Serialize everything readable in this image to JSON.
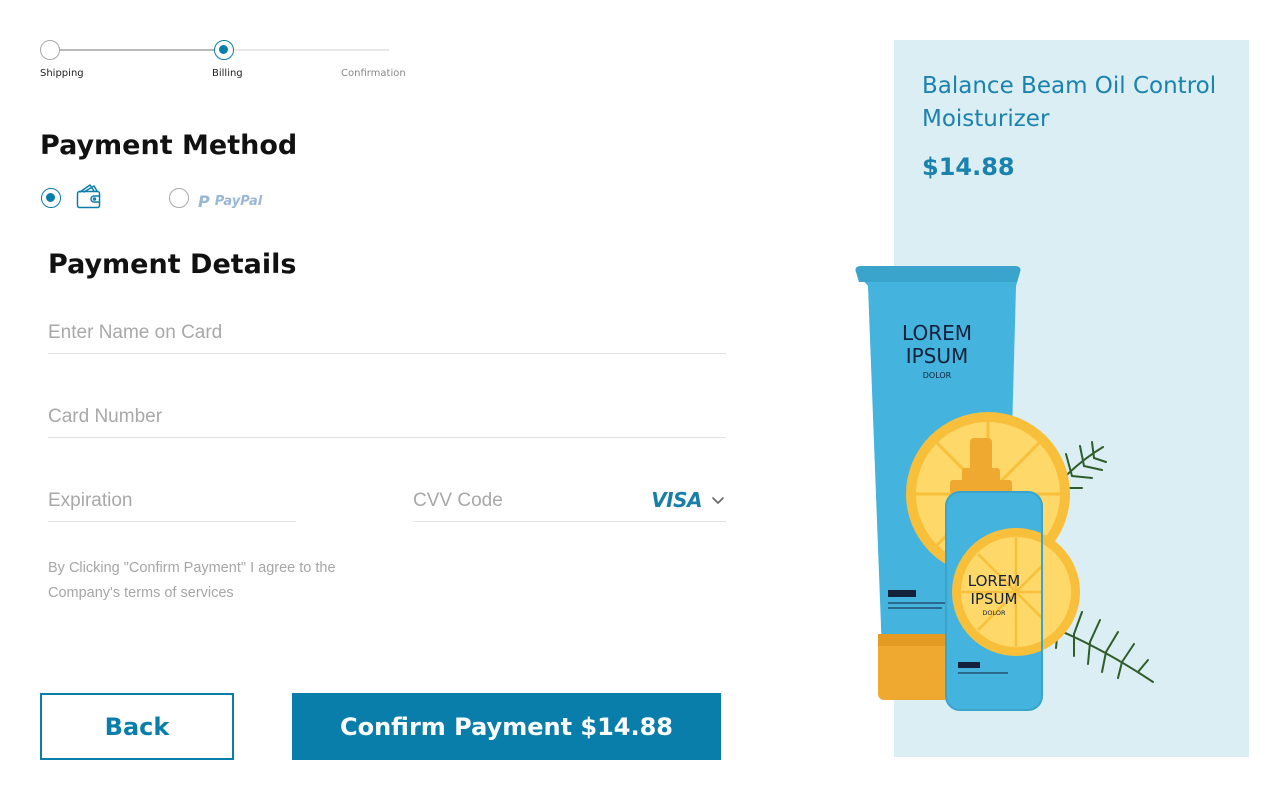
{
  "stepper": {
    "steps": [
      {
        "label": "Shipping",
        "state": "completed"
      },
      {
        "label": "Billing",
        "state": "active"
      },
      {
        "label": "Confirmation",
        "state": "pending"
      }
    ]
  },
  "payment_method": {
    "title": "Payment Method",
    "options": [
      {
        "icon": "wallet-icon",
        "selected": true
      },
      {
        "label": "PayPal",
        "selected": false
      }
    ]
  },
  "payment_details": {
    "title": "Payment Details",
    "name_placeholder": "Enter Name on Card",
    "card_placeholder": "Card Number",
    "expiration_placeholder": "Expiration",
    "cvv_placeholder": "CVV Code",
    "card_brand": "VISA"
  },
  "terms_text": "By Clicking \"Confirm Payment\" I agree to the Company's terms of services",
  "buttons": {
    "back_label": "Back",
    "confirm_label": "Confirm Payment $14.88"
  },
  "product": {
    "name": "Balance Beam Oil Control Moisturizer",
    "price": "$14.88",
    "tube_text": [
      "LOREM",
      "IPSUM",
      "DOLOR"
    ],
    "bottle_text": [
      "LOREM",
      "IPSUM",
      "DOLOR"
    ]
  },
  "colors": {
    "accent": "#0a7eab",
    "panel_bg": "#dbeef4",
    "product_text": "#1a82ad"
  }
}
